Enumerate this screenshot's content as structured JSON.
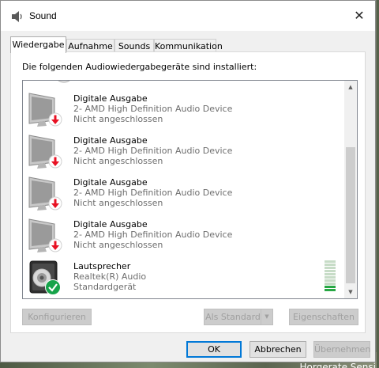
{
  "window": {
    "title": "Sound",
    "close_glyph": "✕"
  },
  "tabs": [
    {
      "label": "Wiedergabe",
      "active": true
    },
    {
      "label": "Aufnahme",
      "active": false
    },
    {
      "label": "Sounds",
      "active": false
    },
    {
      "label": "Kommunikation",
      "active": false
    }
  ],
  "panel": {
    "header": "Die folgenden Audiowiedergabegeräte sind installiert:"
  },
  "devices": [
    {
      "name": "Digitale Ausgabe",
      "driver": "2- AMD High Definition Audio Device",
      "status": "Nicht angeschlossen",
      "icon": "monitor-icon",
      "badge": "disconnected-badge-icon"
    },
    {
      "name": "Digitale Ausgabe",
      "driver": "2- AMD High Definition Audio Device",
      "status": "Nicht angeschlossen",
      "icon": "monitor-icon",
      "badge": "disconnected-badge-icon"
    },
    {
      "name": "Digitale Ausgabe",
      "driver": "2- AMD High Definition Audio Device",
      "status": "Nicht angeschlossen",
      "icon": "monitor-icon",
      "badge": "disconnected-badge-icon"
    },
    {
      "name": "Digitale Ausgabe",
      "driver": "2- AMD High Definition Audio Device",
      "status": "Nicht angeschlossen",
      "icon": "monitor-icon",
      "badge": "disconnected-badge-icon"
    },
    {
      "name": "Lautsprecher",
      "driver": "Realtek(R) Audio",
      "status": "Standardgerät",
      "icon": "speaker-icon",
      "badge": "default-check-badge-icon",
      "level_fraction": 0.2
    }
  ],
  "buttons": {
    "configure": "Konfigurieren",
    "set_default": "Als Standard",
    "properties": "Eigenschaften",
    "ok": "OK",
    "cancel": "Abbrechen",
    "apply": "Übernehmen"
  },
  "background": {
    "partial_text": "Horgerate Sensi"
  },
  "colors": {
    "accent": "#0078d7",
    "disconnected": "#e81123",
    "default_check": "#16a34a",
    "meter_on": "#27a744"
  }
}
